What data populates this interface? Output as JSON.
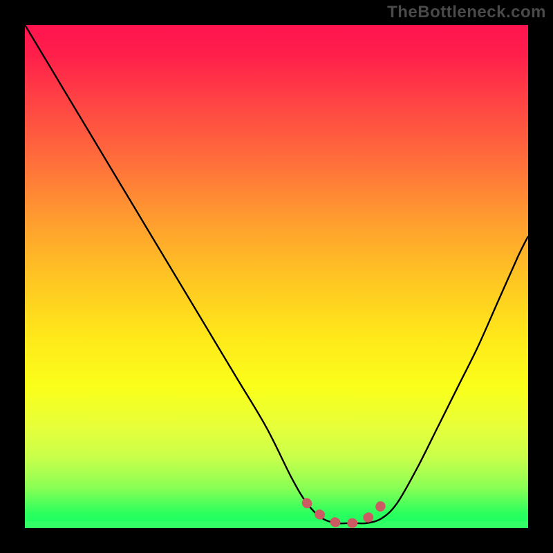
{
  "watermark": "TheBottleneck.com",
  "colors": {
    "curve": "#000000",
    "marker": "#cb5a62",
    "background_black": "#000000"
  },
  "chart_data": {
    "type": "line",
    "title": "",
    "xlabel": "",
    "ylabel": "",
    "x_range": [
      0,
      100
    ],
    "y_range": [
      0,
      100
    ],
    "series": [
      {
        "name": "curve",
        "x": [
          0,
          6,
          12,
          18,
          24,
          30,
          36,
          42,
          48,
          53,
          56,
          59,
          62,
          65,
          68,
          71,
          74,
          78,
          82,
          86,
          90,
          94,
          98,
          100
        ],
        "y": [
          100,
          90,
          80,
          70,
          60,
          50,
          40,
          30,
          20,
          10,
          5,
          2,
          1,
          1,
          1,
          2,
          5,
          12,
          20,
          28,
          36,
          45,
          54,
          58
        ]
      }
    ],
    "markers": {
      "name": "trough-markers",
      "x": [
        56,
        58,
        60,
        62,
        64,
        66,
        68,
        70,
        71
      ],
      "y": [
        5,
        3,
        2,
        1,
        1,
        1,
        2,
        3,
        5
      ]
    },
    "gradient_stops": [
      {
        "pos": 0.0,
        "hex": "#ff1450"
      },
      {
        "pos": 0.5,
        "hex": "#ffe81a"
      },
      {
        "pos": 1.0,
        "hex": "#19ff62"
      }
    ]
  }
}
